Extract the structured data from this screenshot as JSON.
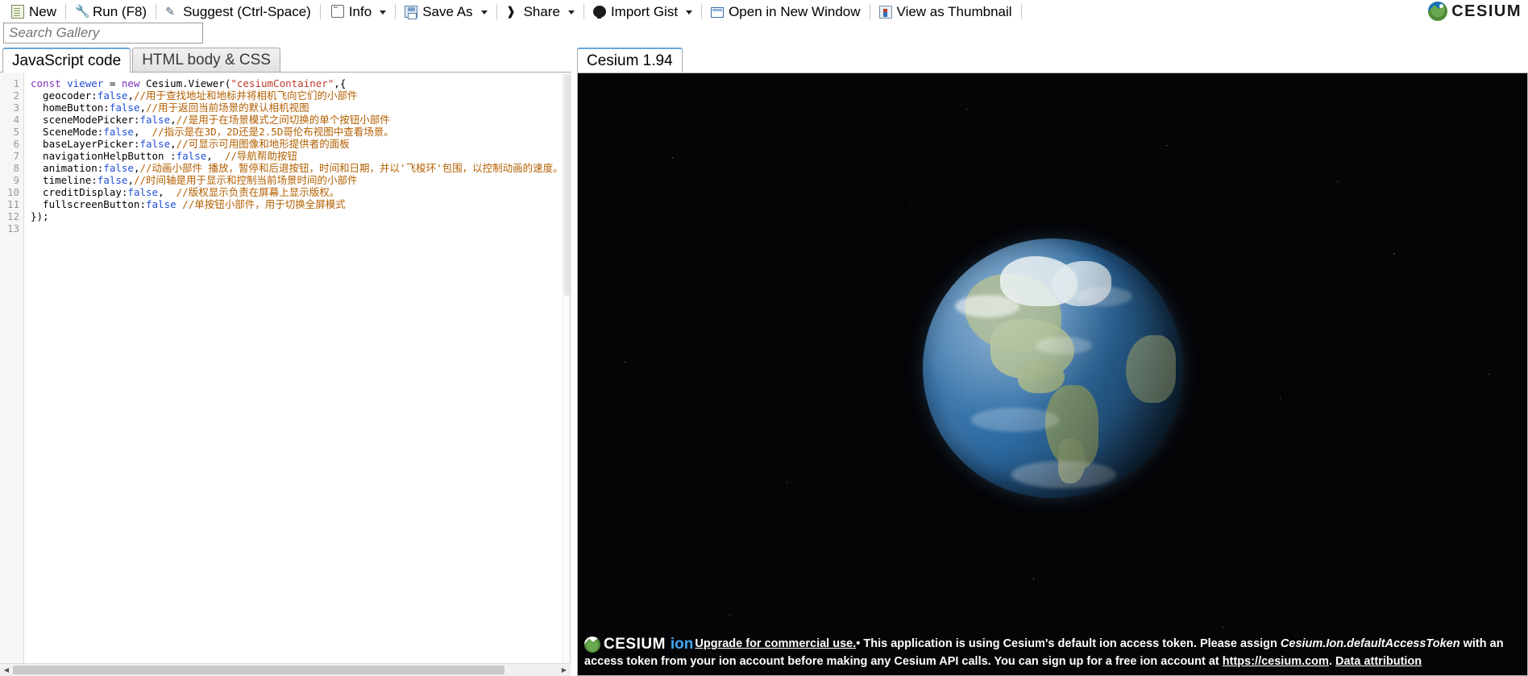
{
  "toolbar": {
    "items": [
      {
        "label": "New",
        "icon": "new-document-icon",
        "caret": false
      },
      {
        "label": "Run (F8)",
        "icon": "run-icon",
        "caret": false
      },
      {
        "label": "Suggest (Ctrl-Space)",
        "icon": "suggest-icon",
        "caret": false
      },
      {
        "label": "Info",
        "icon": "info-icon",
        "caret": true
      },
      {
        "label": "Save As",
        "icon": "save-icon",
        "caret": true
      },
      {
        "label": "Share",
        "icon": "share-icon",
        "caret": true
      },
      {
        "label": "Import Gist",
        "icon": "github-icon",
        "caret": true
      },
      {
        "label": "Open in New Window",
        "icon": "window-icon",
        "caret": false
      },
      {
        "label": "View as Thumbnail",
        "icon": "thumbnail-icon",
        "caret": false
      }
    ],
    "brand": "CESIUM"
  },
  "search": {
    "placeholder": "Search Gallery",
    "value": ""
  },
  "editor": {
    "tabs": [
      {
        "label": "JavaScript code",
        "active": true
      },
      {
        "label": "HTML body & CSS",
        "active": false
      }
    ],
    "line_numbers": [
      "1",
      "2",
      "3",
      "4",
      "5",
      "6",
      "7",
      "8",
      "9",
      "10",
      "11",
      "12",
      "13"
    ],
    "lines": [
      [
        {
          "t": "const ",
          "c": "kw"
        },
        {
          "t": "viewer",
          "c": "var"
        },
        {
          "t": " = ",
          "c": "pln"
        },
        {
          "t": "new ",
          "c": "new"
        },
        {
          "t": "Cesium.Viewer(",
          "c": "pln"
        },
        {
          "t": "\"cesiumContainer\"",
          "c": "str"
        },
        {
          "t": ",{",
          "c": "pln"
        }
      ],
      [
        {
          "t": "  geocoder:",
          "c": "pln"
        },
        {
          "t": "false",
          "c": "bool"
        },
        {
          "t": ",",
          "c": "pln"
        },
        {
          "t": "//用于查找地址和地标并将相机飞向它们的小部件",
          "c": "cmt"
        }
      ],
      [
        {
          "t": "  homeButton:",
          "c": "pln"
        },
        {
          "t": "false",
          "c": "bool"
        },
        {
          "t": ",",
          "c": "pln"
        },
        {
          "t": "//用于返回当前场景的默认相机视图",
          "c": "cmt"
        }
      ],
      [
        {
          "t": "  sceneModePicker:",
          "c": "pln"
        },
        {
          "t": "false",
          "c": "bool"
        },
        {
          "t": ",",
          "c": "pln"
        },
        {
          "t": "//是用于在场景模式之间切换的单个按钮小部件",
          "c": "cmt"
        }
      ],
      [
        {
          "t": "  SceneMode:",
          "c": "pln"
        },
        {
          "t": "false",
          "c": "bool"
        },
        {
          "t": ",  ",
          "c": "pln"
        },
        {
          "t": "//指示是在3D，2D还是2.5D哥伦布视图中查看场景。",
          "c": "cmt"
        }
      ],
      [
        {
          "t": "  baseLayerPicker:",
          "c": "pln"
        },
        {
          "t": "false",
          "c": "bool"
        },
        {
          "t": ",",
          "c": "pln"
        },
        {
          "t": "//可显示可用图像和地形提供者的面板",
          "c": "cmt"
        }
      ],
      [
        {
          "t": "  navigationHelpButton :",
          "c": "pln"
        },
        {
          "t": "false",
          "c": "bool"
        },
        {
          "t": ",  ",
          "c": "pln"
        },
        {
          "t": "//导航帮助按钮",
          "c": "cmt"
        }
      ],
      [
        {
          "t": "  animation:",
          "c": "pln"
        },
        {
          "t": "false",
          "c": "bool"
        },
        {
          "t": ",",
          "c": "pln"
        },
        {
          "t": "//动画小部件 播放，暂停和后退按钮，时间和日期，并以'飞梭环'包围，以控制动画的速度。",
          "c": "cmt"
        }
      ],
      [
        {
          "t": "  timeline:",
          "c": "pln"
        },
        {
          "t": "false",
          "c": "bool"
        },
        {
          "t": ",",
          "c": "pln"
        },
        {
          "t": "//时间轴是用于显示和控制当前场景时间的小部件",
          "c": "cmt"
        }
      ],
      [
        {
          "t": "  creditDisplay:",
          "c": "pln"
        },
        {
          "t": "false",
          "c": "bool"
        },
        {
          "t": ",  ",
          "c": "pln"
        },
        {
          "t": "//版权显示负责在屏幕上显示版权。",
          "c": "cmt"
        }
      ],
      [
        {
          "t": "  fullscreenButton:",
          "c": "pln"
        },
        {
          "t": "false",
          "c": "bool"
        },
        {
          "t": " ",
          "c": "pln"
        },
        {
          "t": "//单按钮小部件，用于切换全屏模式",
          "c": "cmt"
        }
      ],
      [
        {
          "t": "});",
          "c": "pln"
        }
      ],
      []
    ]
  },
  "viewer": {
    "tab_label": "Cesium 1.94",
    "credits": {
      "logo_word": "CESIUM",
      "logo_sub": "ion",
      "upgrade_link": "Upgrade for commercial use.",
      "bullet": "•",
      "text_part1": "This application is using Cesium's default ion access token. Please assign",
      "token_name": "Cesium.Ion.defaultAccessToken",
      "text_part2": "with an access token from your ion account before making any Cesium API calls. You can sign up for a free ion account at",
      "site_link": "https://cesium.com",
      "period": ".",
      "attribution_link": "Data attribution"
    }
  },
  "colors": {
    "accent": "#6aa6de",
    "comment": "#b35f00",
    "string": "#c0392b",
    "keyword": "#7b2fbe",
    "bool": "#1f4fd8",
    "link": "#3fa9f5"
  }
}
